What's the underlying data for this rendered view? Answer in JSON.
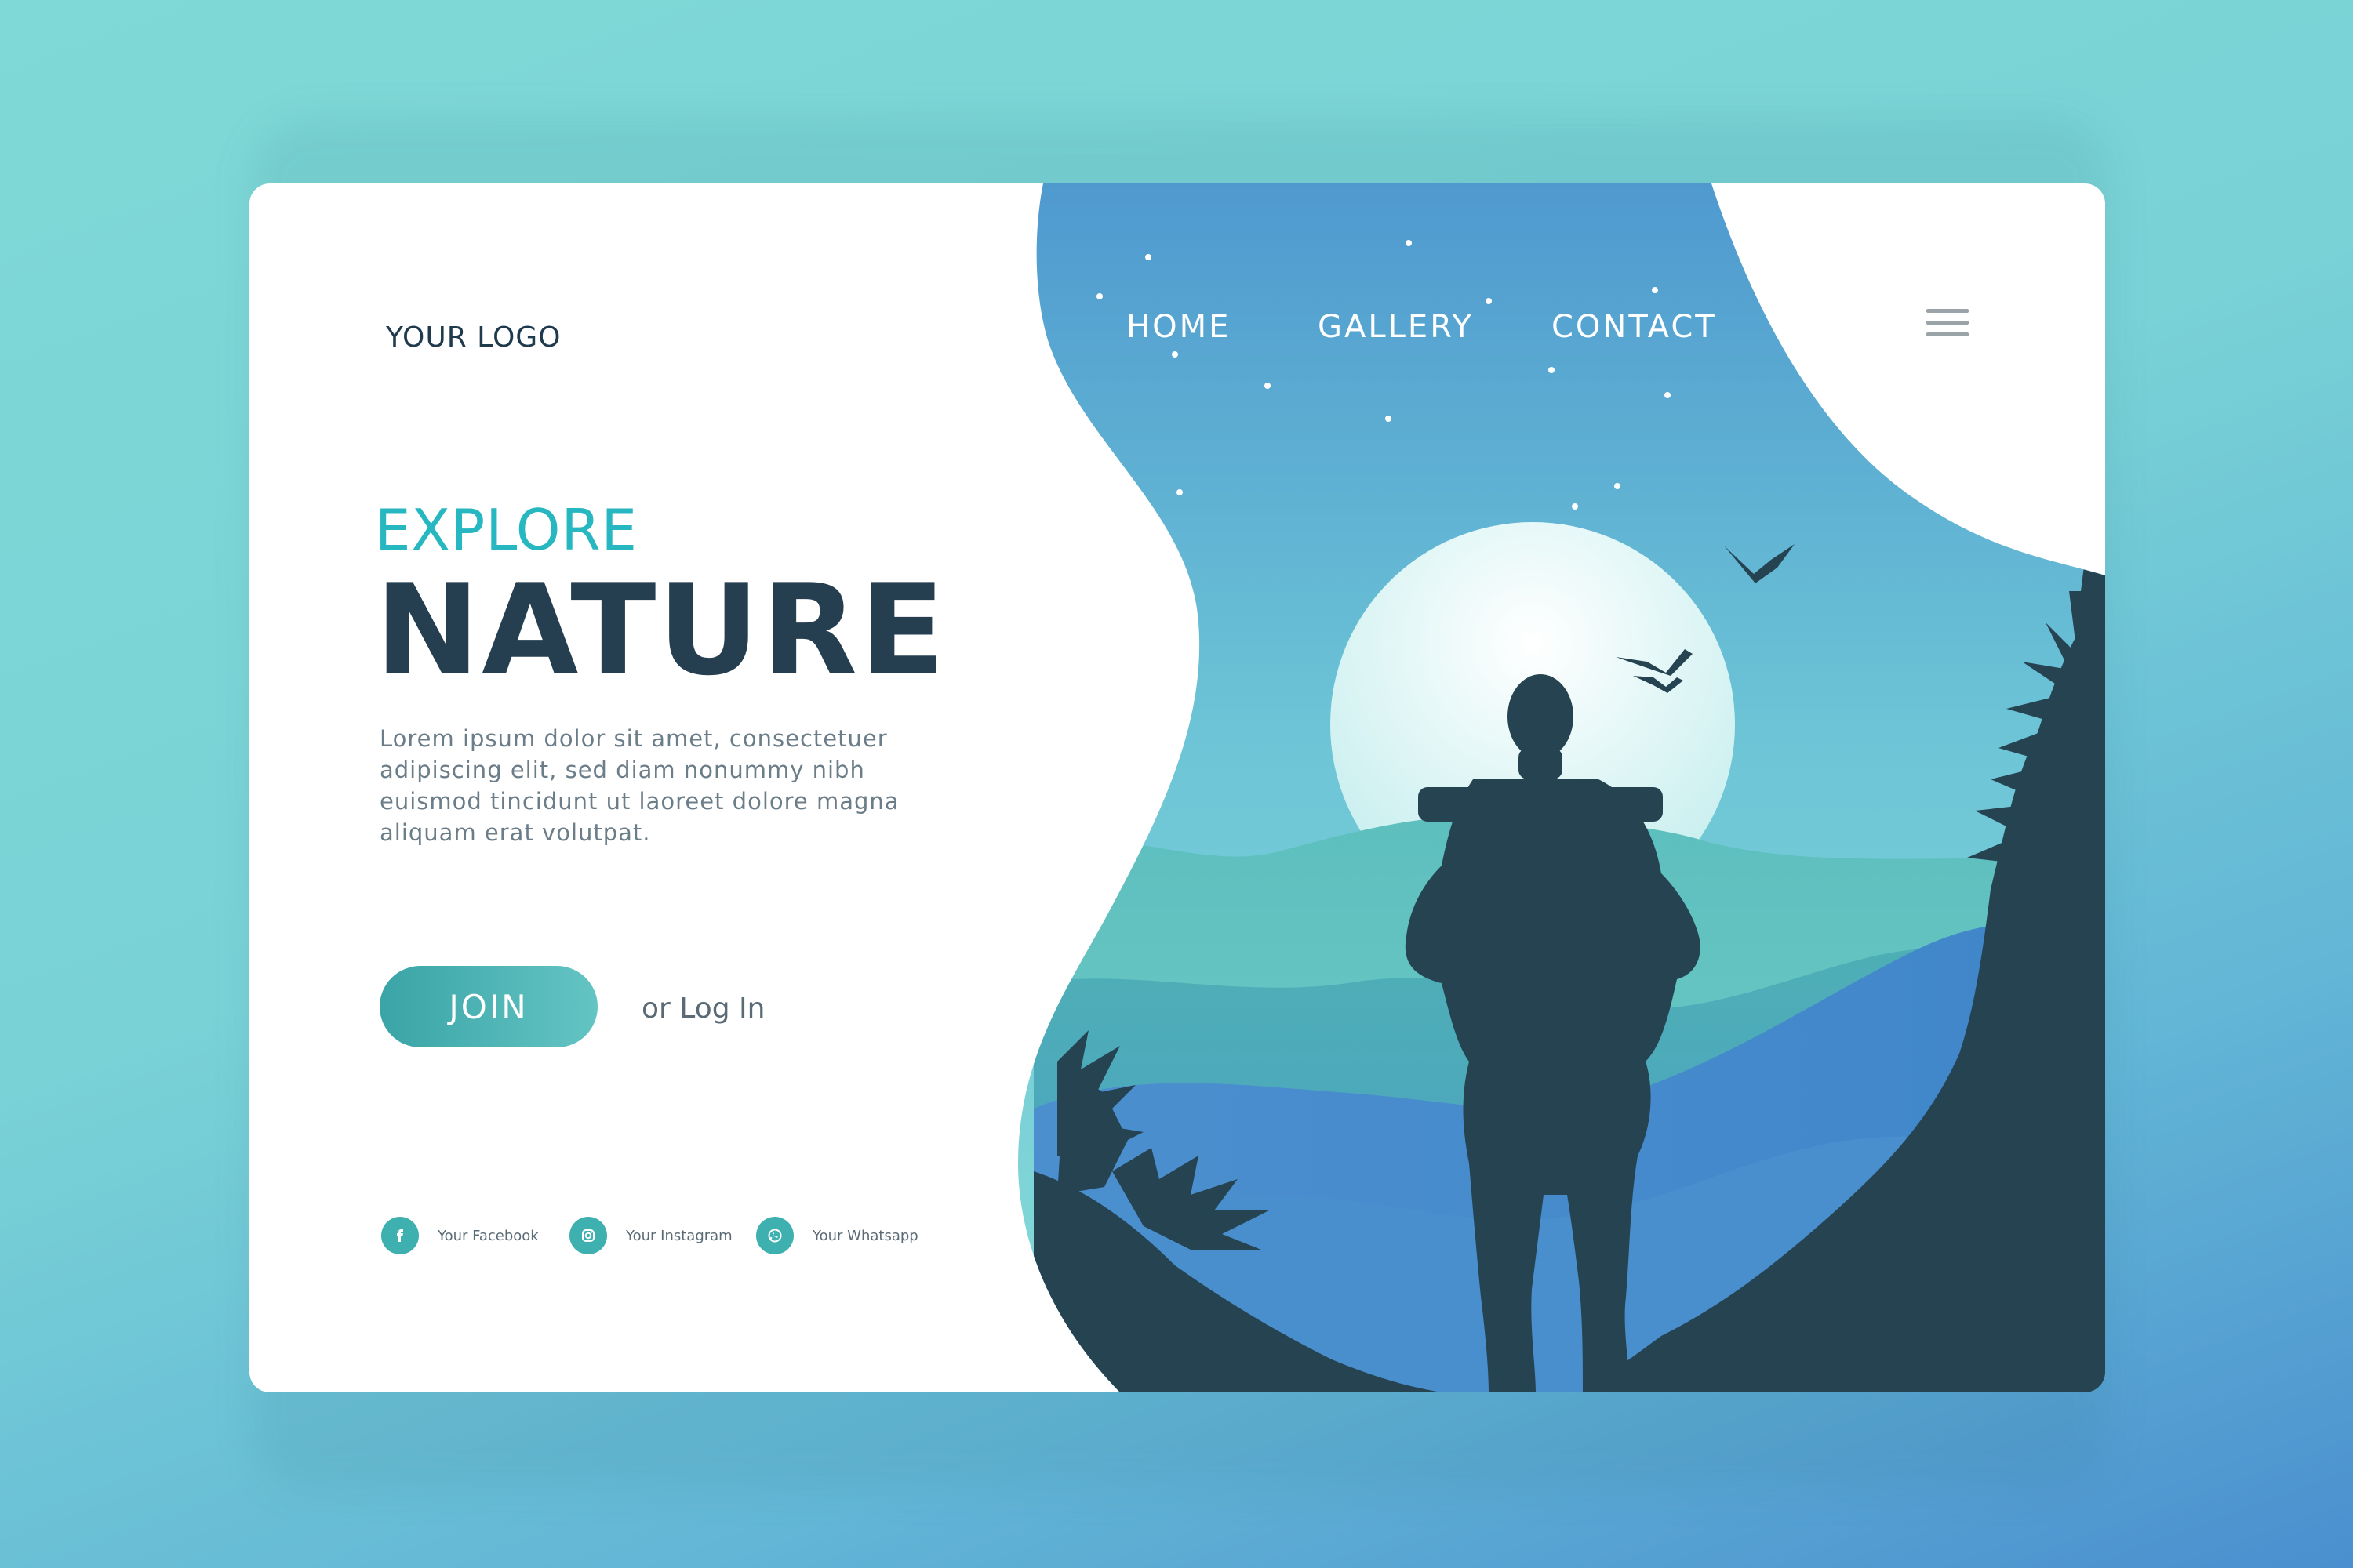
{
  "header": {
    "logo": "YOUR LOGO"
  },
  "nav": {
    "items": [
      "HOME",
      "GALLERY",
      "CONTACT"
    ]
  },
  "hero": {
    "eyebrow": "EXPLORE",
    "title": "NATURE",
    "description": "Lorem ipsum dolor sit amet, consectetuer adipiscing elit, sed diam nonummy nibh euismod tincidunt ut laoreet dolore magna aliquam erat volutpat."
  },
  "actions": {
    "join_label": "JOIN",
    "login_label": "or Log In"
  },
  "social": [
    {
      "label": "Your Facebook",
      "icon": "facebook-icon"
    },
    {
      "label": "Your Instagram",
      "icon": "instagram-icon"
    },
    {
      "label": "Your Whatsapp",
      "icon": "whatsapp-icon"
    }
  ],
  "colors": {
    "accent": "#27b7c0",
    "title": "#253f51",
    "silhouette": "#264352",
    "sky_top": "#4f9bd0",
    "sky_bottom": "#7dd6d6"
  }
}
